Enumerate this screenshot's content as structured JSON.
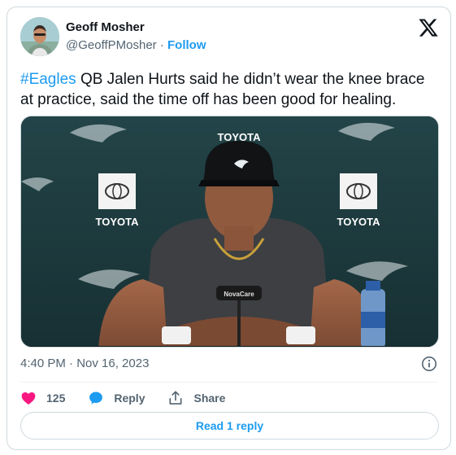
{
  "author": {
    "name": "Geoff Mosher",
    "handle": "@GeoffPMosher",
    "separator": "·",
    "follow_label": "Follow"
  },
  "tweet": {
    "hashtag": "#Eagles",
    "text": " QB Jalen Hurts said he didn’t wear the knee brace at practice, said the time off has been good for healing."
  },
  "media": {
    "backdrop_sponsor": "TOYOTA",
    "mic_sponsor": "NovaCare"
  },
  "meta": {
    "timestamp": "4:40 PM · Nov 16, 2023"
  },
  "actions": {
    "like_count": "125",
    "reply_label": "Reply",
    "share_label": "Share"
  },
  "read_replies_label": "Read 1 reply",
  "colors": {
    "accent": "#1d9bf0",
    "like": "#f91880",
    "muted": "#536471",
    "border": "#cfd9de"
  }
}
